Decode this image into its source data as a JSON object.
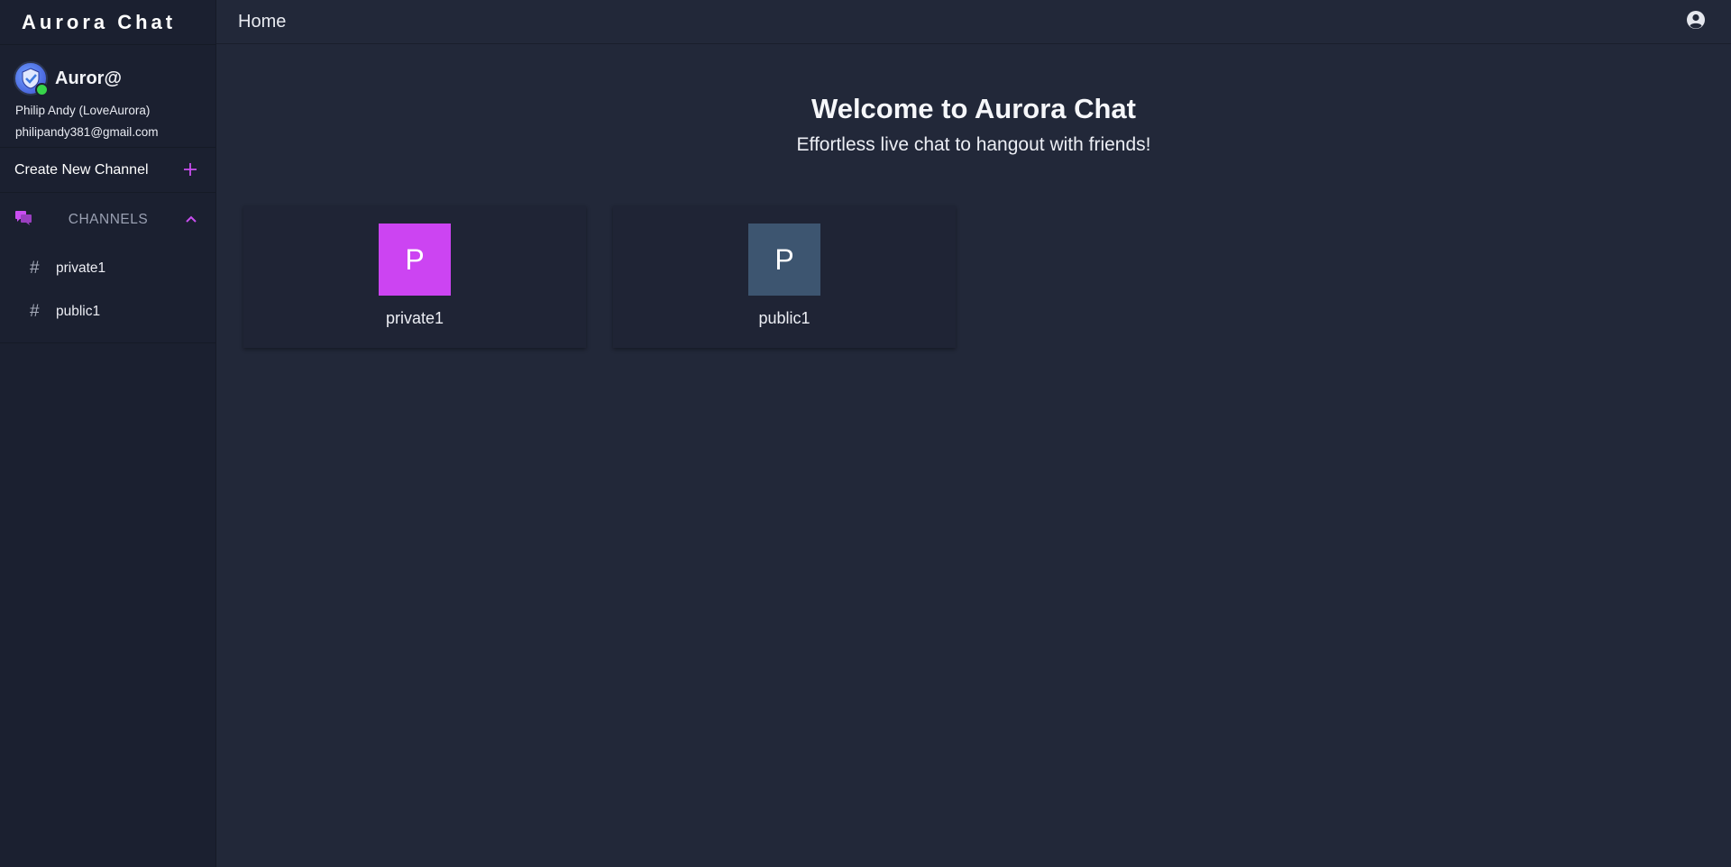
{
  "brand": "Aurora Chat",
  "profile": {
    "app_name": "Auror@",
    "user": "Philip Andy (LoveAurora)",
    "email": "philipandy381@gmail.com"
  },
  "sidebar": {
    "create_label": "Create New Channel",
    "channels_label": "CHANNELS",
    "channels": [
      {
        "name": "private1"
      },
      {
        "name": "public1"
      }
    ]
  },
  "topbar": {
    "title": "Home"
  },
  "main": {
    "heading": "Welcome to Aurora Chat",
    "subheading": "Effortless live chat to hangout with friends!",
    "cards": [
      {
        "initial": "P",
        "name": "private1",
        "color": "#cc44f2"
      },
      {
        "initial": "P",
        "name": "public1",
        "color": "#3d5570"
      }
    ]
  },
  "colors": {
    "accent": "#c94ef0",
    "background": "#222839",
    "sidebar": "#1b2030",
    "online": "#37d44a"
  },
  "icons": {
    "avatar": "shield-avatar-icon",
    "create": "plus-icon",
    "channels": "chat-bubbles-icon",
    "collapse": "chevron-up-icon",
    "channel": "hash-icon",
    "account": "account-circle-icon"
  }
}
